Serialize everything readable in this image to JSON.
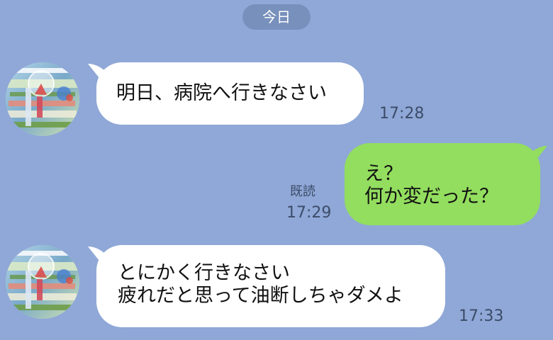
{
  "date_pill": "今日",
  "messages": [
    {
      "text": "明日、病院へ行きなさい",
      "time": "17:28"
    },
    {
      "lines": [
        "え？",
        "何か変だった？"
      ],
      "read": "既読",
      "time": "17:29"
    },
    {
      "lines": [
        "とにかく行きなさい",
        "疲れだと思って油断しちゃダメよ"
      ],
      "time": "17:33"
    }
  ],
  "colors": {
    "background": "#8FA8D7",
    "outgoing_bubble": "#93DD5F",
    "incoming_bubble": "#FFFFFF",
    "date_pill": "#7890BC"
  }
}
